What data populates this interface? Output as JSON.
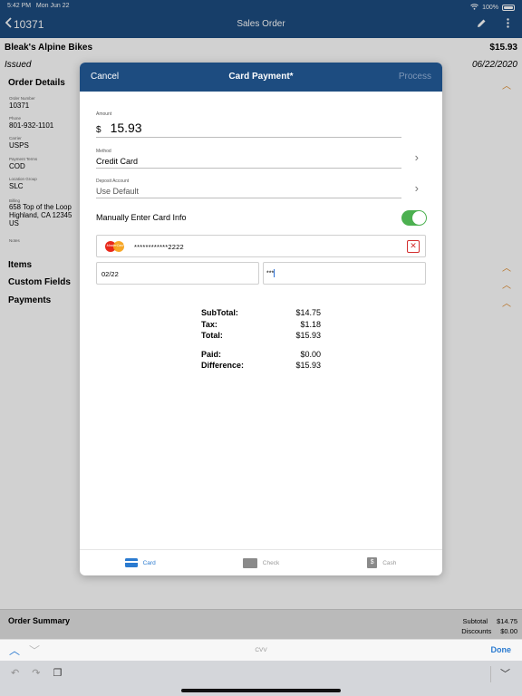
{
  "status_bar": {
    "time": "5:42 PM",
    "date": "Mon Jun 22",
    "battery": "100%"
  },
  "nav": {
    "back_label": "10371",
    "title": "Sales Order"
  },
  "order": {
    "customer": "Bleak's Alpine Bikes",
    "total": "$15.93",
    "status": "Issued",
    "date": "06/22/2020",
    "details_title": "Order Details",
    "fields": [
      {
        "label": "Order Number",
        "value": "10371"
      },
      {
        "label": "Phone",
        "value": "801-932-1101"
      },
      {
        "label": "Carrier",
        "value": "USPS"
      },
      {
        "label": "Payment Terms",
        "value": "COD"
      },
      {
        "label": "Location Group",
        "value": "SLC"
      },
      {
        "label": "Billing",
        "value": "658 Top of the Loop\nHighland, CA 12345\nUS"
      },
      {
        "label": "Notes",
        "value": ""
      }
    ],
    "sections": [
      "Items",
      "Custom Fields",
      "Payments"
    ]
  },
  "modal": {
    "cancel": "Cancel",
    "title": "Card Payment*",
    "process": "Process",
    "amount_label": "Amount",
    "currency": "$",
    "amount": "15.93",
    "method_label": "Method",
    "method": "Credit Card",
    "deposit_label": "Deposit Account",
    "deposit": "Use Default",
    "manual_label": "Manually Enter Card Info",
    "manual_enabled": true,
    "card_brand": "MasterCard",
    "card_number": "************2222",
    "expiration": "02/22",
    "cvv": "***",
    "summary": {
      "subtotal_label": "SubTotal:",
      "subtotal": "$14.75",
      "tax_label": "Tax:",
      "tax": "$1.18",
      "total_label": "Total:",
      "total": "$15.93",
      "paid_label": "Paid:",
      "paid": "$0.00",
      "difference_label": "Difference:",
      "difference": "$15.93"
    },
    "tabs": [
      {
        "label": "Card",
        "icon": "card-icon",
        "active": true
      },
      {
        "label": "Check",
        "icon": "check-icon",
        "active": false
      },
      {
        "label": "Cash",
        "icon": "cash-icon",
        "active": false
      }
    ]
  },
  "order_summary": {
    "title": "Order Summary",
    "subtotal_label": "Subtotal",
    "subtotal": "$14.75",
    "discounts_label": "Discounts",
    "discounts": "$0.00"
  },
  "accessory": {
    "field_label": "CVV",
    "done": "Done"
  },
  "colors": {
    "header": "#1d4c80",
    "accent": "#e08a2c",
    "toggle_on": "#4cb050",
    "link": "#2b7bd0"
  }
}
